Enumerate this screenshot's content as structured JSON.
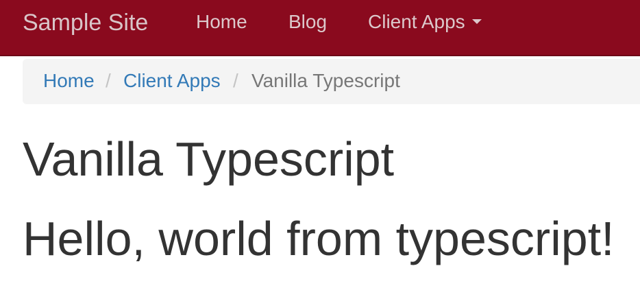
{
  "navbar": {
    "brand": "Sample Site",
    "items": [
      {
        "label": "Home"
      },
      {
        "label": "Blog"
      },
      {
        "label": "Client Apps",
        "icon": "caret-down-icon"
      }
    ],
    "background_color": "#8a0a1e"
  },
  "breadcrumb": {
    "items": [
      {
        "label": "Home"
      },
      {
        "label": "Client Apps"
      },
      {
        "label": "Vanilla Typescript"
      }
    ],
    "separator": "/"
  },
  "main": {
    "title": "Vanilla Typescript",
    "message": "Hello, world from typescript!"
  }
}
